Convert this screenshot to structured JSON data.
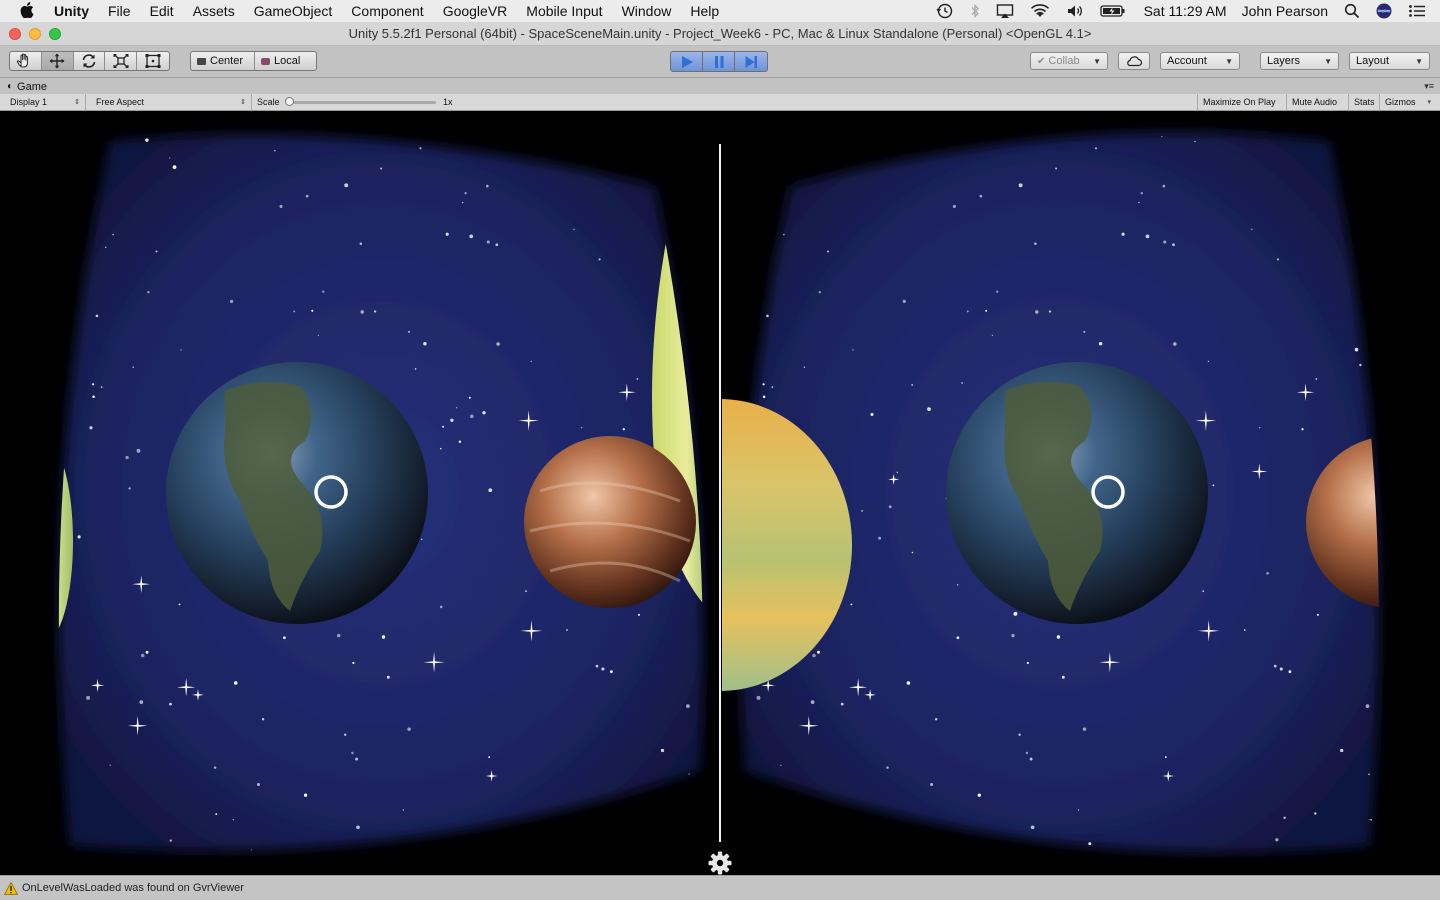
{
  "menubar": {
    "app_name": "Unity",
    "items": [
      "File",
      "Edit",
      "Assets",
      "GameObject",
      "Component",
      "GoogleVR",
      "Mobile Input",
      "Window",
      "Help"
    ],
    "clock": "Sat 11:29 AM",
    "user": "John Pearson"
  },
  "window": {
    "title": "Unity 5.5.2f1 Personal (64bit) - SpaceSceneMain.unity - Project_Week6 - PC, Mac & Linux Standalone (Personal) <OpenGL 4.1>"
  },
  "toolbar": {
    "pivot_center": "Center",
    "pivot_local": "Local",
    "collab": "Collab",
    "account": "Account",
    "layers": "Layers",
    "layout": "Layout",
    "play_accent": "#2f6fd6"
  },
  "game_tab": {
    "label": "Game"
  },
  "game_bar": {
    "display": "Display 1",
    "aspect": "Free Aspect",
    "scale_label": "Scale",
    "scale_value": "1x",
    "maximize": "Maximize On Play",
    "mute": "Mute Audio",
    "stats": "Stats",
    "gizmos": "Gizmos"
  },
  "status": {
    "message": "OnLevelWasLoaded was found on GvrViewer",
    "icon": "warning-icon"
  }
}
